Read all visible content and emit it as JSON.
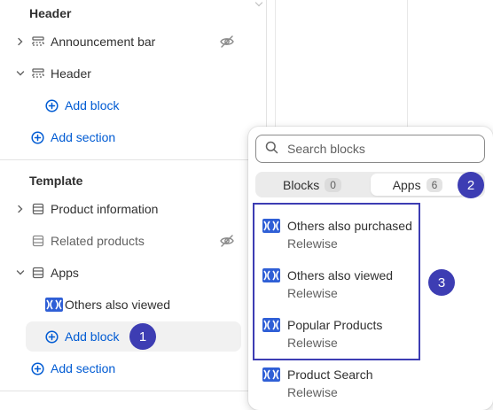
{
  "sidebar": {
    "header_section": {
      "title": "Header",
      "announcement_bar": "Announcement bar",
      "header": "Header",
      "add_block": "Add block",
      "add_section": "Add section"
    },
    "template_section": {
      "title": "Template",
      "product_information": "Product information",
      "related_products": "Related products",
      "apps": "Apps",
      "others_also_viewed": "Others also viewed",
      "add_block": "Add block",
      "add_section": "Add section"
    }
  },
  "popover": {
    "search_placeholder": "Search blocks",
    "tabs": [
      {
        "label": "Blocks",
        "count": "0"
      },
      {
        "label": "Apps",
        "count": "6"
      }
    ],
    "items": [
      {
        "name": "Others also purchased",
        "vendor": "Relewise"
      },
      {
        "name": "Others also viewed",
        "vendor": "Relewise"
      },
      {
        "name": "Popular Products",
        "vendor": "Relewise"
      },
      {
        "name": "Product Search",
        "vendor": "Relewise"
      }
    ]
  },
  "annotations": {
    "badge_1": "1",
    "badge_2": "2",
    "badge_3": "3"
  },
  "colors": {
    "accent_blue": "#005bd3",
    "annotation_purple": "#3d3db3",
    "app_logo_blue": "#2f5fd6"
  }
}
